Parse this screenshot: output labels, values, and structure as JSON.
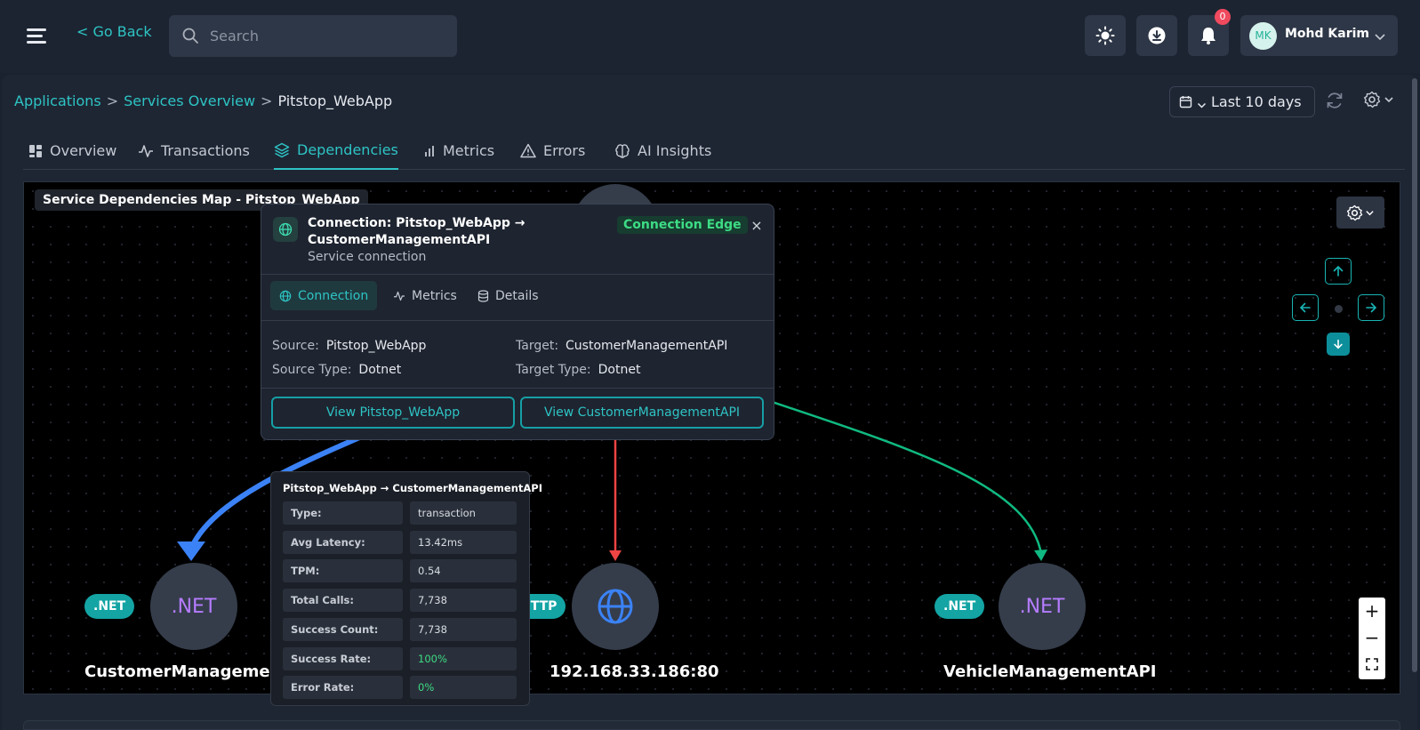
{
  "topbar": {
    "go_back": "< Go Back",
    "search_placeholder": "Search",
    "notification_count": "0",
    "user": {
      "initials": "MK",
      "name": "Mohd Karim"
    }
  },
  "breadcrumb": {
    "items": [
      "Applications",
      "Services Overview",
      "Pitstop_WebApp"
    ],
    "separator": ">"
  },
  "date_range": "Last 10 days",
  "tabs": [
    {
      "label": "Overview",
      "icon": "dashboard-icon"
    },
    {
      "label": "Transactions",
      "icon": "activity-icon"
    },
    {
      "label": "Dependencies",
      "icon": "layers-icon",
      "active": true
    },
    {
      "label": "Metrics",
      "icon": "bar-chart-icon"
    },
    {
      "label": "Errors",
      "icon": "warning-icon"
    },
    {
      "label": "AI Insights",
      "icon": "brain-icon"
    }
  ],
  "map": {
    "title": "Service Dependencies Map - Pitstop_WebApp",
    "nodes": [
      {
        "label": "CustomerManagementAPI",
        "type_badge": ".NET",
        "icon_text": ".NET"
      },
      {
        "label": "192.168.33.186:80",
        "type_badge": "HTTP",
        "icon": "globe-icon"
      },
      {
        "label": "VehicleManagementAPI",
        "type_badge": ".NET",
        "icon_text": ".NET"
      }
    ],
    "edge_colors": {
      "selected": "#3b82f6",
      "error": "#ef4444",
      "ok": "#10b981"
    }
  },
  "popup": {
    "title": "Connection: Pitstop_WebApp → CustomerManagementAPI",
    "subtitle": "Service connection",
    "badge": "Connection Edge",
    "close": "×",
    "tabs": [
      "Connection",
      "Metrics",
      "Details"
    ],
    "fields": {
      "source_label": "Source:",
      "source": "Pitstop_WebApp",
      "target_label": "Target:",
      "target": "CustomerManagementAPI",
      "source_type_label": "Source Type:",
      "source_type": "Dotnet",
      "target_type_label": "Target Type:",
      "target_type": "Dotnet"
    },
    "buttons": [
      "View Pitstop_WebApp",
      "View CustomerManagementAPI"
    ]
  },
  "tooltip": {
    "title": "Pitstop_WebApp → CustomerManagementAPI",
    "rows": [
      {
        "label": "Type:",
        "value": "transaction"
      },
      {
        "label": "Avg Latency:",
        "value": "13.42ms"
      },
      {
        "label": "TPM:",
        "value": "0.54"
      },
      {
        "label": "Total Calls:",
        "value": "7,738"
      },
      {
        "label": "Success Count:",
        "value": "7,738"
      },
      {
        "label": "Success Rate:",
        "value": "100%",
        "color": "#3ddc84"
      },
      {
        "label": "Error Rate:",
        "value": "0%",
        "color": "#3ddc84"
      }
    ]
  },
  "colors": {
    "accent": "#2ec4c4",
    "badge_red": "#f04a5e",
    "success": "#3ddc84"
  }
}
